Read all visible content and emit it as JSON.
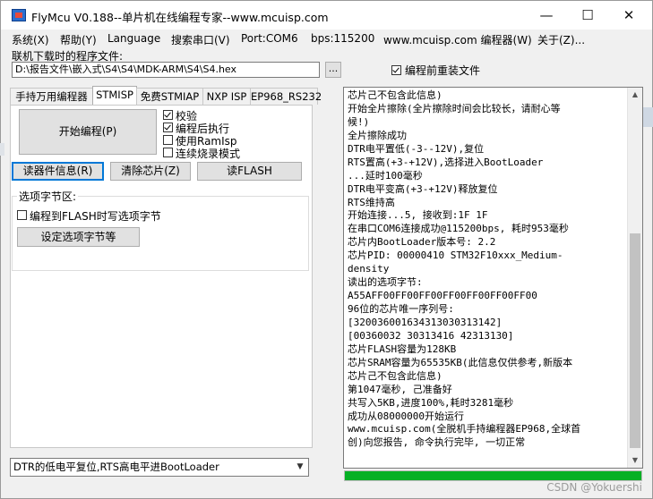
{
  "window": {
    "title": "FlyMcu V0.188--单片机在线编程专家--www.mcuisp.com",
    "minimize_glyph": "—",
    "maximize_glyph": "☐",
    "close_glyph": "✕"
  },
  "menu": [
    "系统(X)",
    "帮助(Y)",
    "Language",
    "搜索串口(V)",
    "Port:COM6",
    "bps:115200",
    "www.mcuisp.com 编程器(W)",
    "关于(Z)..."
  ],
  "file": {
    "label": "联机下载时的程序文件:",
    "path": "D:\\报告文件\\嵌入式\\S4\\S4\\MDK-ARM\\S4\\S4.hex",
    "browse_label": "...",
    "reload_label": "编程前重装文件",
    "reload_checked": true
  },
  "tabs": [
    "手持万用编程器",
    "STMISP",
    "免费STMIAP",
    "NXP ISP",
    "EP968_RS232"
  ],
  "active_tab": 1,
  "actions": {
    "program_label": "开始编程(P)",
    "options": [
      {
        "label": "校验",
        "checked": true
      },
      {
        "label": "编程后执行",
        "checked": true
      },
      {
        "label": "使用RamIsp",
        "checked": false
      },
      {
        "label": "连续烧录模式",
        "checked": false
      }
    ],
    "read_info_label": "读器件信息(R)",
    "erase_label": "清除芯片(Z)",
    "read_flash_label": "读FLASH"
  },
  "option_bytes": {
    "group_title": "选项字节区:",
    "write_label": "编程到FLASH时写选项字节",
    "write_checked": false,
    "set_button_label": "设定选项字节等"
  },
  "reset_mode": {
    "selected": "DTR的低电平复位,RTS高电平进BootLoader"
  },
  "log": [
    "芯片己不包含此信息)",
    "开始全片擦除(全片擦除时间会比较长，请耐心等",
    "候!)",
    "全片擦除成功",
    "DTR电平置低(-3--12V),复位",
    "RTS置高(+3-+12V),选择进入BootLoader",
    "...延时100毫秒",
    "DTR电平变高(+3-+12V)释放复位",
    "RTS维持高",
    "开始连接...5, 接收到:1F 1F",
    "在串口COM6连接成功@115200bps, 耗时953毫秒",
    "芯片内BootLoader版本号: 2.2",
    "芯片PID: 00000410  STM32F10xxx_Medium-",
    "density",
    "读出的选项字节:",
    "A55AFF00FF00FF00FF00FF00FF00FF00",
    "96位的芯片唯一序列号:",
    "[3200360016343130303131​42]",
    "[00360032 30313416 42313130]",
    "芯片FLASH容量为128KB",
    "芯片SRAM容量为65535KB(此信息仅供参考,新版本",
    "芯片己不包含此信息)",
    "第1047毫秒, 己准备好",
    "共写入5KB,进度100%,耗时3281毫秒",
    "成功从08000000开始运行",
    "www.mcuisp.com(全脱机手持编程器EP968,全球首",
    "创)向您报告, 命令执行完毕, 一切正常"
  ],
  "progress": {
    "percent": 100,
    "color": "#06b025"
  },
  "watermark": "CSDN @Yokuershi"
}
